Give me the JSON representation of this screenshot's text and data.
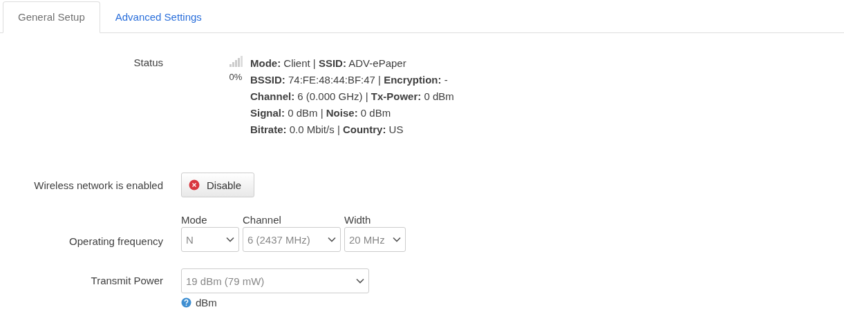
{
  "tabs": [
    {
      "label": "General Setup",
      "selected": true
    },
    {
      "label": "Advanced Settings",
      "selected": false
    }
  ],
  "fields": [
    {
      "kind": "status",
      "label": "Status",
      "signal": "0%",
      "lines": [
        "**Mode:** Client | **SSID:** ADV-ePaper",
        "**BSSID:** 74:FE:48:44:BF:47 | **Encryption:** -",
        "**Channel:** 6 (0.000 GHz) | **Tx-Power:** 0 dBm",
        "**Signal:** 0 dBm | **Noise:** 0 dBm",
        "**Bitrate:** 0.0 Mbit/s | **Country:** US"
      ]
    },
    {
      "kind": "button",
      "label": "Wireless network is enabled",
      "button": "Disable"
    },
    {
      "kind": "selects",
      "label": "Operating frequency",
      "selects": [
        {
          "caption": "Mode",
          "value": "N"
        },
        {
          "caption": "Channel",
          "value": "6 (2437 MHz)"
        },
        {
          "caption": "Width",
          "value": "20 MHz"
        }
      ]
    },
    {
      "kind": "select",
      "label": "Transmit Power",
      "value": "19 dBm (79 mW)",
      "help": "dBm"
    }
  ]
}
